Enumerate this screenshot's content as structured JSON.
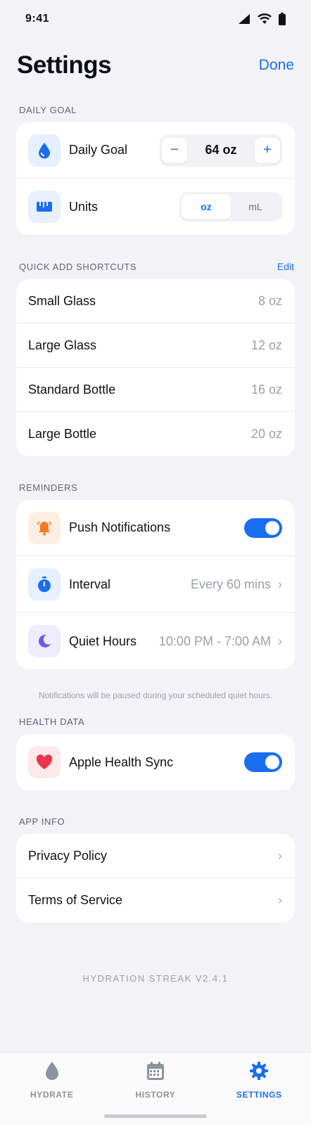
{
  "status_bar": {
    "time": "9:41"
  },
  "header": {
    "title": "Settings",
    "done_label": "Done"
  },
  "daily_goal_section": {
    "label": "DAILY GOAL",
    "goal_row": {
      "label": "Daily Goal",
      "value": "64 oz",
      "minus": "−",
      "plus": "+"
    },
    "units_row": {
      "label": "Units",
      "options": [
        "oz",
        "mL"
      ],
      "selected": "oz"
    }
  },
  "quick_add_section": {
    "label": "QUICK ADD SHORTCUTS",
    "edit_label": "Edit",
    "items": [
      {
        "label": "Small Glass",
        "value": "8 oz"
      },
      {
        "label": "Large Glass",
        "value": "12 oz"
      },
      {
        "label": "Standard Bottle",
        "value": "16 oz"
      },
      {
        "label": "Large Bottle",
        "value": "20 oz"
      }
    ]
  },
  "reminders_section": {
    "label": "REMINDERS",
    "push": {
      "label": "Push Notifications",
      "enabled": true
    },
    "interval": {
      "label": "Interval",
      "value": "Every 60 mins"
    },
    "quiet_hours": {
      "label": "Quiet Hours",
      "value": "10:00 PM - 7:00 AM"
    },
    "footnote": "Notifications will be paused during your scheduled quiet hours."
  },
  "health_section": {
    "label": "HEALTH DATA",
    "apple_health": {
      "label": "Apple Health Sync",
      "enabled": true
    }
  },
  "app_info_section": {
    "label": "APP INFO",
    "items": [
      {
        "label": "Privacy Policy"
      },
      {
        "label": "Terms of Service"
      }
    ]
  },
  "version": "HYDRATION STREAK V2.4.1",
  "tabbar": {
    "tabs": [
      {
        "label": "HYDRATE",
        "icon": "drop-icon",
        "active": false
      },
      {
        "label": "HISTORY",
        "icon": "calendar-icon",
        "active": false
      },
      {
        "label": "SETTINGS",
        "icon": "gear-icon",
        "active": true
      }
    ]
  },
  "colors": {
    "accent": "#1a6df0",
    "background": "#f2f2f7",
    "orange": "#f47a1f",
    "purple": "#6a5ae0",
    "red": "#e9364a"
  }
}
